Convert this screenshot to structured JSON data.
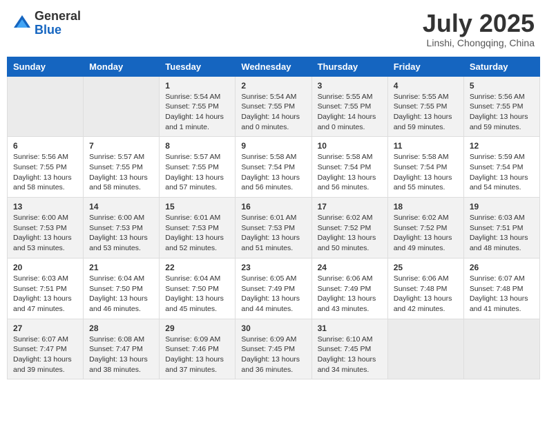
{
  "logo": {
    "general": "General",
    "blue": "Blue"
  },
  "title": "July 2025",
  "location": "Linshi, Chongqing, China",
  "days_of_week": [
    "Sunday",
    "Monday",
    "Tuesday",
    "Wednesday",
    "Thursday",
    "Friday",
    "Saturday"
  ],
  "weeks": [
    [
      {
        "day": "",
        "sunrise": "",
        "sunset": "",
        "daylight": ""
      },
      {
        "day": "",
        "sunrise": "",
        "sunset": "",
        "daylight": ""
      },
      {
        "day": "1",
        "sunrise": "Sunrise: 5:54 AM",
        "sunset": "Sunset: 7:55 PM",
        "daylight": "Daylight: 14 hours and 1 minute."
      },
      {
        "day": "2",
        "sunrise": "Sunrise: 5:54 AM",
        "sunset": "Sunset: 7:55 PM",
        "daylight": "Daylight: 14 hours and 0 minutes."
      },
      {
        "day": "3",
        "sunrise": "Sunrise: 5:55 AM",
        "sunset": "Sunset: 7:55 PM",
        "daylight": "Daylight: 14 hours and 0 minutes."
      },
      {
        "day": "4",
        "sunrise": "Sunrise: 5:55 AM",
        "sunset": "Sunset: 7:55 PM",
        "daylight": "Daylight: 13 hours and 59 minutes."
      },
      {
        "day": "5",
        "sunrise": "Sunrise: 5:56 AM",
        "sunset": "Sunset: 7:55 PM",
        "daylight": "Daylight: 13 hours and 59 minutes."
      }
    ],
    [
      {
        "day": "6",
        "sunrise": "Sunrise: 5:56 AM",
        "sunset": "Sunset: 7:55 PM",
        "daylight": "Daylight: 13 hours and 58 minutes."
      },
      {
        "day": "7",
        "sunrise": "Sunrise: 5:57 AM",
        "sunset": "Sunset: 7:55 PM",
        "daylight": "Daylight: 13 hours and 58 minutes."
      },
      {
        "day": "8",
        "sunrise": "Sunrise: 5:57 AM",
        "sunset": "Sunset: 7:55 PM",
        "daylight": "Daylight: 13 hours and 57 minutes."
      },
      {
        "day": "9",
        "sunrise": "Sunrise: 5:58 AM",
        "sunset": "Sunset: 7:54 PM",
        "daylight": "Daylight: 13 hours and 56 minutes."
      },
      {
        "day": "10",
        "sunrise": "Sunrise: 5:58 AM",
        "sunset": "Sunset: 7:54 PM",
        "daylight": "Daylight: 13 hours and 56 minutes."
      },
      {
        "day": "11",
        "sunrise": "Sunrise: 5:58 AM",
        "sunset": "Sunset: 7:54 PM",
        "daylight": "Daylight: 13 hours and 55 minutes."
      },
      {
        "day": "12",
        "sunrise": "Sunrise: 5:59 AM",
        "sunset": "Sunset: 7:54 PM",
        "daylight": "Daylight: 13 hours and 54 minutes."
      }
    ],
    [
      {
        "day": "13",
        "sunrise": "Sunrise: 6:00 AM",
        "sunset": "Sunset: 7:53 PM",
        "daylight": "Daylight: 13 hours and 53 minutes."
      },
      {
        "day": "14",
        "sunrise": "Sunrise: 6:00 AM",
        "sunset": "Sunset: 7:53 PM",
        "daylight": "Daylight: 13 hours and 53 minutes."
      },
      {
        "day": "15",
        "sunrise": "Sunrise: 6:01 AM",
        "sunset": "Sunset: 7:53 PM",
        "daylight": "Daylight: 13 hours and 52 minutes."
      },
      {
        "day": "16",
        "sunrise": "Sunrise: 6:01 AM",
        "sunset": "Sunset: 7:53 PM",
        "daylight": "Daylight: 13 hours and 51 minutes."
      },
      {
        "day": "17",
        "sunrise": "Sunrise: 6:02 AM",
        "sunset": "Sunset: 7:52 PM",
        "daylight": "Daylight: 13 hours and 50 minutes."
      },
      {
        "day": "18",
        "sunrise": "Sunrise: 6:02 AM",
        "sunset": "Sunset: 7:52 PM",
        "daylight": "Daylight: 13 hours and 49 minutes."
      },
      {
        "day": "19",
        "sunrise": "Sunrise: 6:03 AM",
        "sunset": "Sunset: 7:51 PM",
        "daylight": "Daylight: 13 hours and 48 minutes."
      }
    ],
    [
      {
        "day": "20",
        "sunrise": "Sunrise: 6:03 AM",
        "sunset": "Sunset: 7:51 PM",
        "daylight": "Daylight: 13 hours and 47 minutes."
      },
      {
        "day": "21",
        "sunrise": "Sunrise: 6:04 AM",
        "sunset": "Sunset: 7:50 PM",
        "daylight": "Daylight: 13 hours and 46 minutes."
      },
      {
        "day": "22",
        "sunrise": "Sunrise: 6:04 AM",
        "sunset": "Sunset: 7:50 PM",
        "daylight": "Daylight: 13 hours and 45 minutes."
      },
      {
        "day": "23",
        "sunrise": "Sunrise: 6:05 AM",
        "sunset": "Sunset: 7:49 PM",
        "daylight": "Daylight: 13 hours and 44 minutes."
      },
      {
        "day": "24",
        "sunrise": "Sunrise: 6:06 AM",
        "sunset": "Sunset: 7:49 PM",
        "daylight": "Daylight: 13 hours and 43 minutes."
      },
      {
        "day": "25",
        "sunrise": "Sunrise: 6:06 AM",
        "sunset": "Sunset: 7:48 PM",
        "daylight": "Daylight: 13 hours and 42 minutes."
      },
      {
        "day": "26",
        "sunrise": "Sunrise: 6:07 AM",
        "sunset": "Sunset: 7:48 PM",
        "daylight": "Daylight: 13 hours and 41 minutes."
      }
    ],
    [
      {
        "day": "27",
        "sunrise": "Sunrise: 6:07 AM",
        "sunset": "Sunset: 7:47 PM",
        "daylight": "Daylight: 13 hours and 39 minutes."
      },
      {
        "day": "28",
        "sunrise": "Sunrise: 6:08 AM",
        "sunset": "Sunset: 7:47 PM",
        "daylight": "Daylight: 13 hours and 38 minutes."
      },
      {
        "day": "29",
        "sunrise": "Sunrise: 6:09 AM",
        "sunset": "Sunset: 7:46 PM",
        "daylight": "Daylight: 13 hours and 37 minutes."
      },
      {
        "day": "30",
        "sunrise": "Sunrise: 6:09 AM",
        "sunset": "Sunset: 7:45 PM",
        "daylight": "Daylight: 13 hours and 36 minutes."
      },
      {
        "day": "31",
        "sunrise": "Sunrise: 6:10 AM",
        "sunset": "Sunset: 7:45 PM",
        "daylight": "Daylight: 13 hours and 34 minutes."
      },
      {
        "day": "",
        "sunrise": "",
        "sunset": "",
        "daylight": ""
      },
      {
        "day": "",
        "sunrise": "",
        "sunset": "",
        "daylight": ""
      }
    ]
  ]
}
